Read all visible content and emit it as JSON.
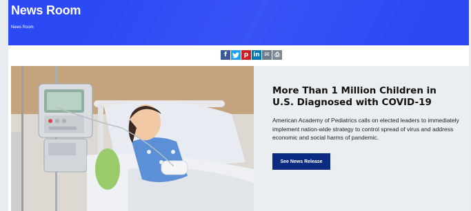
{
  "header": {
    "title": "News Room",
    "breadcrumb": "News Room",
    "background": "#2b49f5"
  },
  "share": {
    "buttons": [
      {
        "name": "facebook",
        "glyph": "f",
        "color": "#3b5998"
      },
      {
        "name": "twitter",
        "glyph": "t",
        "color": "#1da1f2"
      },
      {
        "name": "pinterest",
        "glyph": "p",
        "color": "#cb2027"
      },
      {
        "name": "linkedin",
        "glyph": "in",
        "color": "#0077b5"
      },
      {
        "name": "email",
        "glyph": "✉",
        "color": "#6d7d8c"
      },
      {
        "name": "print",
        "glyph": "⎙",
        "color": "#7a8894"
      }
    ]
  },
  "feature": {
    "image_alt": "Child in hospital bed",
    "headline": "More Than 1 Million Children in U.S. Diagnosed with COVID-19",
    "description": "American Academy of Pediatrics calls on elected leaders to immediately implement nation-wide strategy to control spread of virus and address economic and social harms of pandemic.",
    "cta_label": "See News Release",
    "cta_color": "#0b2b83"
  }
}
